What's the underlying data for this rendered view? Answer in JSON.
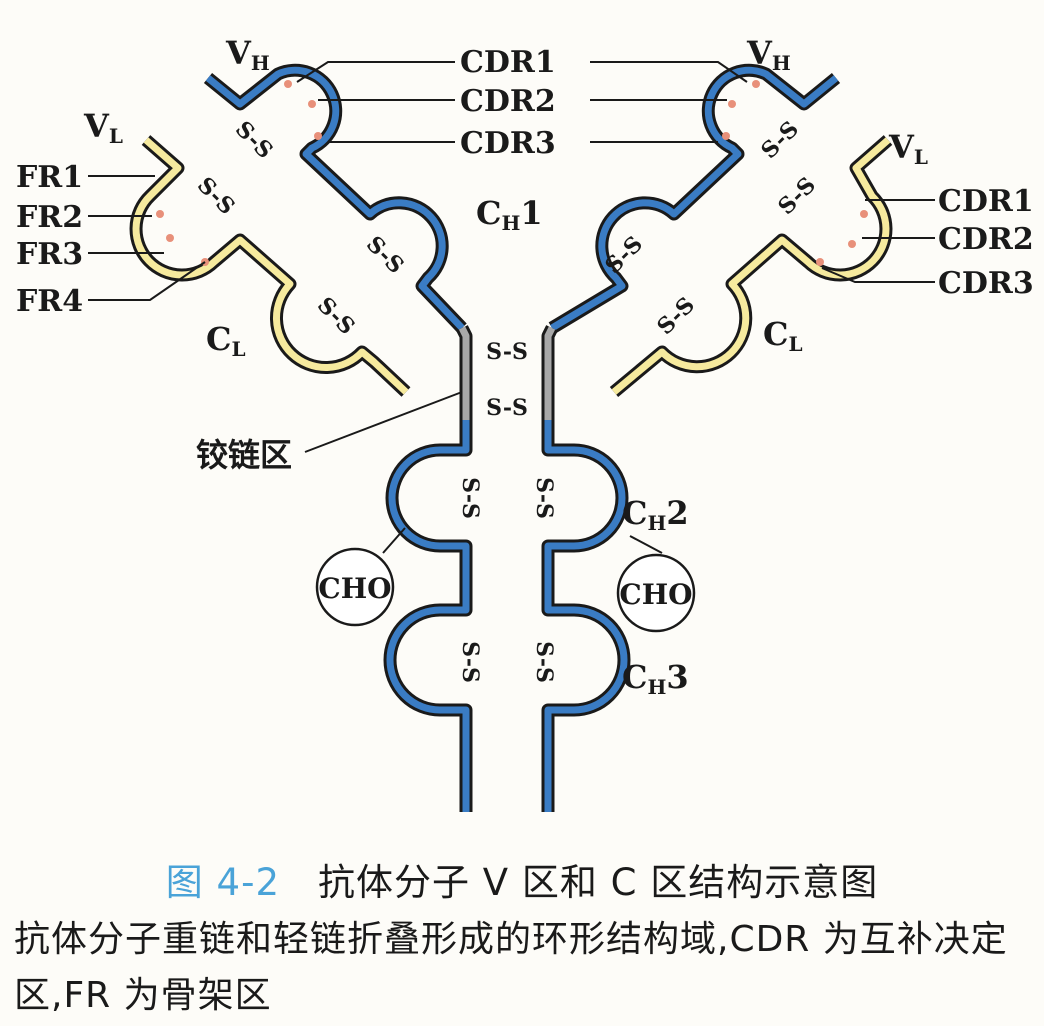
{
  "labels": {
    "vh": "V",
    "vh_sub": "H",
    "vl": "V",
    "vl_sub": "L",
    "ch1": "C",
    "ch1_sub": "H",
    "ch1_num": "1",
    "ch2": "C",
    "ch2_sub": "H",
    "ch2_num": "2",
    "ch3": "C",
    "ch3_sub": "H",
    "ch3_num": "3",
    "cl": "C",
    "cl_sub": "L",
    "cdr1": "CDR1",
    "cdr2": "CDR2",
    "cdr3": "CDR3",
    "fr1": "FR1",
    "fr2": "FR2",
    "fr3": "FR3",
    "fr4": "FR4",
    "cho": "CHO",
    "ss": "S-S",
    "hinge": "铰链区"
  },
  "caption": {
    "figure_no": "图 4-2",
    "title": "抗体分子 V 区和 C 区结构示意图"
  },
  "description": "抗体分子重链和轻链折叠形成的环形结构域,CDR 为互补决定区,FR 为骨架区",
  "colors": {
    "heavy_chain": "#3a7cc4",
    "light_chain": "#f6ea9e",
    "hinge": "#a8a8a8",
    "cdr": "#e8907a",
    "outline": "#1a1a1a",
    "caption_accent": "#4aa3d8"
  }
}
